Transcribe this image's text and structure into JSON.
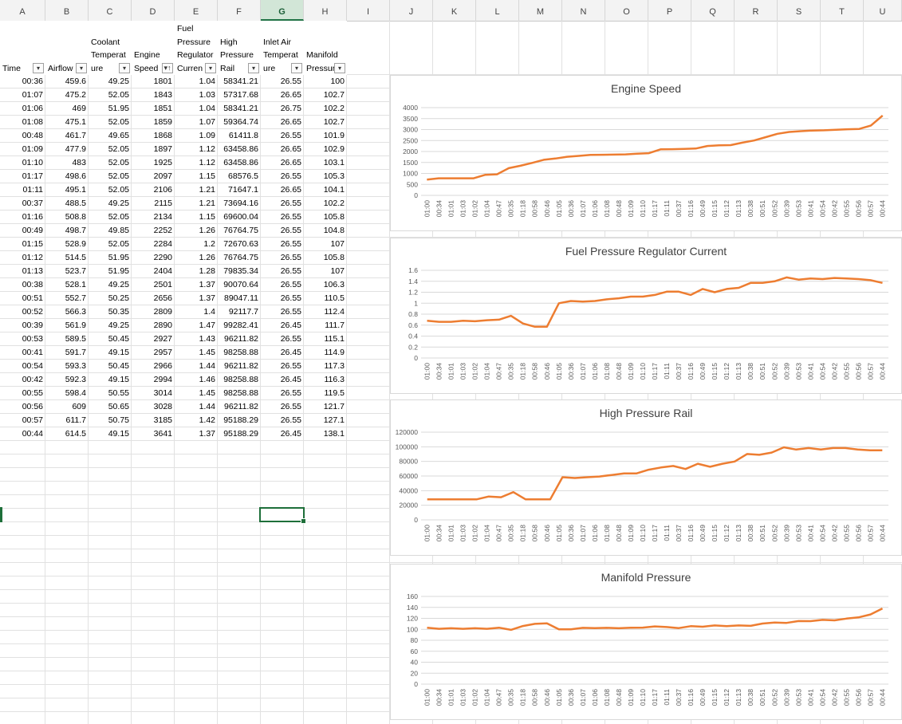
{
  "column_headers": [
    "A",
    "B",
    "C",
    "D",
    "E",
    "F",
    "G",
    "H",
    "I",
    "J",
    "K",
    "L",
    "M",
    "N",
    "O",
    "P",
    "Q",
    "R",
    "S",
    "T",
    "U"
  ],
  "selected_column": "G",
  "table": {
    "headers": [
      {
        "label": "Time",
        "filter": "dropdown"
      },
      {
        "label": "Airflow",
        "filter": "dropdown"
      },
      {
        "label": "Coolant\nTemperat\nure",
        "filter": "dropdown"
      },
      {
        "label": "Engine\nSpeed",
        "filter": "sorted-ascending"
      },
      {
        "label": "Fuel\nPressure\nRegulator\nCurren",
        "filter": "dropdown"
      },
      {
        "label": "High\nPressure\nRail",
        "filter": "dropdown"
      },
      {
        "label": "Inlet Air\nTemperat\nure",
        "filter": "dropdown"
      },
      {
        "label": "Manifold\nPressur",
        "filter": "dropdown"
      }
    ],
    "rows": [
      [
        "00:36",
        "459.6",
        "49.25",
        "1801",
        "1.04",
        "58341.21",
        "26.55",
        "100"
      ],
      [
        "01:07",
        "475.2",
        "52.05",
        "1843",
        "1.03",
        "57317.68",
        "26.65",
        "102.7"
      ],
      [
        "01:06",
        "469",
        "51.95",
        "1851",
        "1.04",
        "58341.21",
        "26.75",
        "102.2"
      ],
      [
        "01:08",
        "475.1",
        "52.05",
        "1859",
        "1.07",
        "59364.74",
        "26.65",
        "102.7"
      ],
      [
        "00:48",
        "461.7",
        "49.65",
        "1868",
        "1.09",
        "61411.8",
        "26.55",
        "101.9"
      ],
      [
        "01:09",
        "477.9",
        "52.05",
        "1897",
        "1.12",
        "63458.86",
        "26.65",
        "102.9"
      ],
      [
        "01:10",
        "483",
        "52.05",
        "1925",
        "1.12",
        "63458.86",
        "26.65",
        "103.1"
      ],
      [
        "01:17",
        "498.6",
        "52.05",
        "2097",
        "1.15",
        "68576.5",
        "26.55",
        "105.3"
      ],
      [
        "01:11",
        "495.1",
        "52.05",
        "2106",
        "1.21",
        "71647.1",
        "26.65",
        "104.1"
      ],
      [
        "00:37",
        "488.5",
        "49.25",
        "2115",
        "1.21",
        "73694.16",
        "26.55",
        "102.2"
      ],
      [
        "01:16",
        "508.8",
        "52.05",
        "2134",
        "1.15",
        "69600.04",
        "26.55",
        "105.8"
      ],
      [
        "00:49",
        "498.7",
        "49.85",
        "2252",
        "1.26",
        "76764.75",
        "26.55",
        "104.8"
      ],
      [
        "01:15",
        "528.9",
        "52.05",
        "2284",
        "1.2",
        "72670.63",
        "26.55",
        "107"
      ],
      [
        "01:12",
        "514.5",
        "51.95",
        "2290",
        "1.26",
        "76764.75",
        "26.55",
        "105.8"
      ],
      [
        "01:13",
        "523.7",
        "51.95",
        "2404",
        "1.28",
        "79835.34",
        "26.55",
        "107"
      ],
      [
        "00:38",
        "528.1",
        "49.25",
        "2501",
        "1.37",
        "90070.64",
        "26.55",
        "106.3"
      ],
      [
        "00:51",
        "552.7",
        "50.25",
        "2656",
        "1.37",
        "89047.11",
        "26.55",
        "110.5"
      ],
      [
        "00:52",
        "566.3",
        "50.35",
        "2809",
        "1.4",
        "92117.7",
        "26.55",
        "112.4"
      ],
      [
        "00:39",
        "561.9",
        "49.25",
        "2890",
        "1.47",
        "99282.41",
        "26.45",
        "111.7"
      ],
      [
        "00:53",
        "589.5",
        "50.45",
        "2927",
        "1.43",
        "96211.82",
        "26.55",
        "115.1"
      ],
      [
        "00:41",
        "591.7",
        "49.15",
        "2957",
        "1.45",
        "98258.88",
        "26.45",
        "114.9"
      ],
      [
        "00:54",
        "593.3",
        "50.45",
        "2966",
        "1.44",
        "96211.82",
        "26.55",
        "117.3"
      ],
      [
        "00:42",
        "592.3",
        "49.15",
        "2994",
        "1.46",
        "98258.88",
        "26.45",
        "116.3"
      ],
      [
        "00:55",
        "598.4",
        "50.55",
        "3014",
        "1.45",
        "98258.88",
        "26.55",
        "119.5"
      ],
      [
        "00:56",
        "609",
        "50.65",
        "3028",
        "1.44",
        "96211.82",
        "26.55",
        "121.7"
      ],
      [
        "00:57",
        "611.7",
        "50.75",
        "3185",
        "1.42",
        "95188.29",
        "26.55",
        "127.1"
      ],
      [
        "00:44",
        "614.5",
        "49.15",
        "3641",
        "1.37",
        "95188.29",
        "26.45",
        "138.1"
      ]
    ]
  },
  "colors": {
    "line": "#ed7d31",
    "grid": "#d9d9d9",
    "axis_text": "#595959",
    "title": "#404040",
    "selection": "#1e6f3a"
  },
  "chart_categories": [
    "01:00",
    "00:34",
    "01:01",
    "01:03",
    "01:02",
    "01:04",
    "00:47",
    "00:35",
    "01:18",
    "00:58",
    "00:46",
    "01:05",
    "00:36",
    "01:07",
    "01:06",
    "01:08",
    "00:48",
    "01:09",
    "01:10",
    "01:17",
    "01:11",
    "00:37",
    "01:16",
    "00:49",
    "01:15",
    "01:12",
    "01:13",
    "00:38",
    "00:51",
    "00:52",
    "00:39",
    "00:53",
    "00:41",
    "00:54",
    "00:42",
    "00:55",
    "00:56",
    "00:57",
    "00:44"
  ],
  "chart_data": [
    {
      "type": "line",
      "title": "Engine Speed",
      "ylim": [
        0,
        4000
      ],
      "yticks": [
        "0",
        "500",
        "1000",
        "1500",
        "2000",
        "2500",
        "3000",
        "3500",
        "4000"
      ],
      "values": [
        720,
        780,
        780,
        780,
        780,
        940,
        960,
        1240,
        1350,
        1480,
        1620,
        1680,
        1760,
        1801,
        1843,
        1851,
        1859,
        1868,
        1897,
        1925,
        2097,
        2106,
        2115,
        2134,
        2252,
        2284,
        2290,
        2404,
        2501,
        2656,
        2809,
        2890,
        2927,
        2957,
        2966,
        2994,
        3014,
        3028,
        3185,
        3641
      ]
    },
    {
      "type": "line",
      "title": "Fuel Pressure Regulator Current",
      "ylim": [
        0,
        1.6
      ],
      "yticks": [
        "0",
        "0.2",
        "0.4",
        "0.6",
        "0.8",
        "1",
        "1.2",
        "1.4",
        "1.6"
      ],
      "values": [
        0.68,
        0.66,
        0.66,
        0.68,
        0.67,
        0.69,
        0.7,
        0.77,
        0.63,
        0.57,
        0.57,
        1.0,
        1.04,
        1.03,
        1.04,
        1.07,
        1.09,
        1.12,
        1.12,
        1.15,
        1.21,
        1.21,
        1.15,
        1.26,
        1.2,
        1.26,
        1.28,
        1.37,
        1.37,
        1.4,
        1.47,
        1.43,
        1.45,
        1.44,
        1.46,
        1.45,
        1.44,
        1.42,
        1.37
      ]
    },
    {
      "type": "line",
      "title": "High Pressure Rail",
      "ylim": [
        0,
        120000
      ],
      "yticks": [
        "0",
        "20000",
        "40000",
        "60000",
        "80000",
        "100000",
        "120000"
      ],
      "values": [
        28000,
        28000,
        28000,
        28000,
        28000,
        32000,
        31000,
        38000,
        28000,
        28000,
        28000,
        58341.21,
        57317.68,
        58341.21,
        59364.74,
        61411.8,
        63458.86,
        63458.86,
        68576.5,
        71647.1,
        73694.16,
        69600.04,
        76764.75,
        72670.63,
        76764.75,
        79835.34,
        90070.64,
        89047.11,
        92117.7,
        99282.41,
        96211.82,
        98258.88,
        96211.82,
        98258.88,
        98258.88,
        96211.82,
        95188.29,
        95188.29
      ]
    },
    {
      "type": "line",
      "title": "Manifold Pressure",
      "ylim": [
        0,
        160
      ],
      "yticks": [
        "0",
        "20",
        "40",
        "60",
        "80",
        "100",
        "120",
        "140",
        "160"
      ],
      "values": [
        103,
        101,
        102,
        101,
        102,
        101,
        103,
        99,
        106,
        110,
        111,
        100,
        100,
        102.7,
        102.2,
        102.7,
        101.9,
        102.9,
        103.1,
        105.3,
        104.1,
        102.2,
        105.8,
        104.8,
        107,
        105.8,
        107,
        106.3,
        110.5,
        112.4,
        111.7,
        115.1,
        114.9,
        117.3,
        116.3,
        119.5,
        121.7,
        127.1,
        138.1
      ]
    }
  ]
}
